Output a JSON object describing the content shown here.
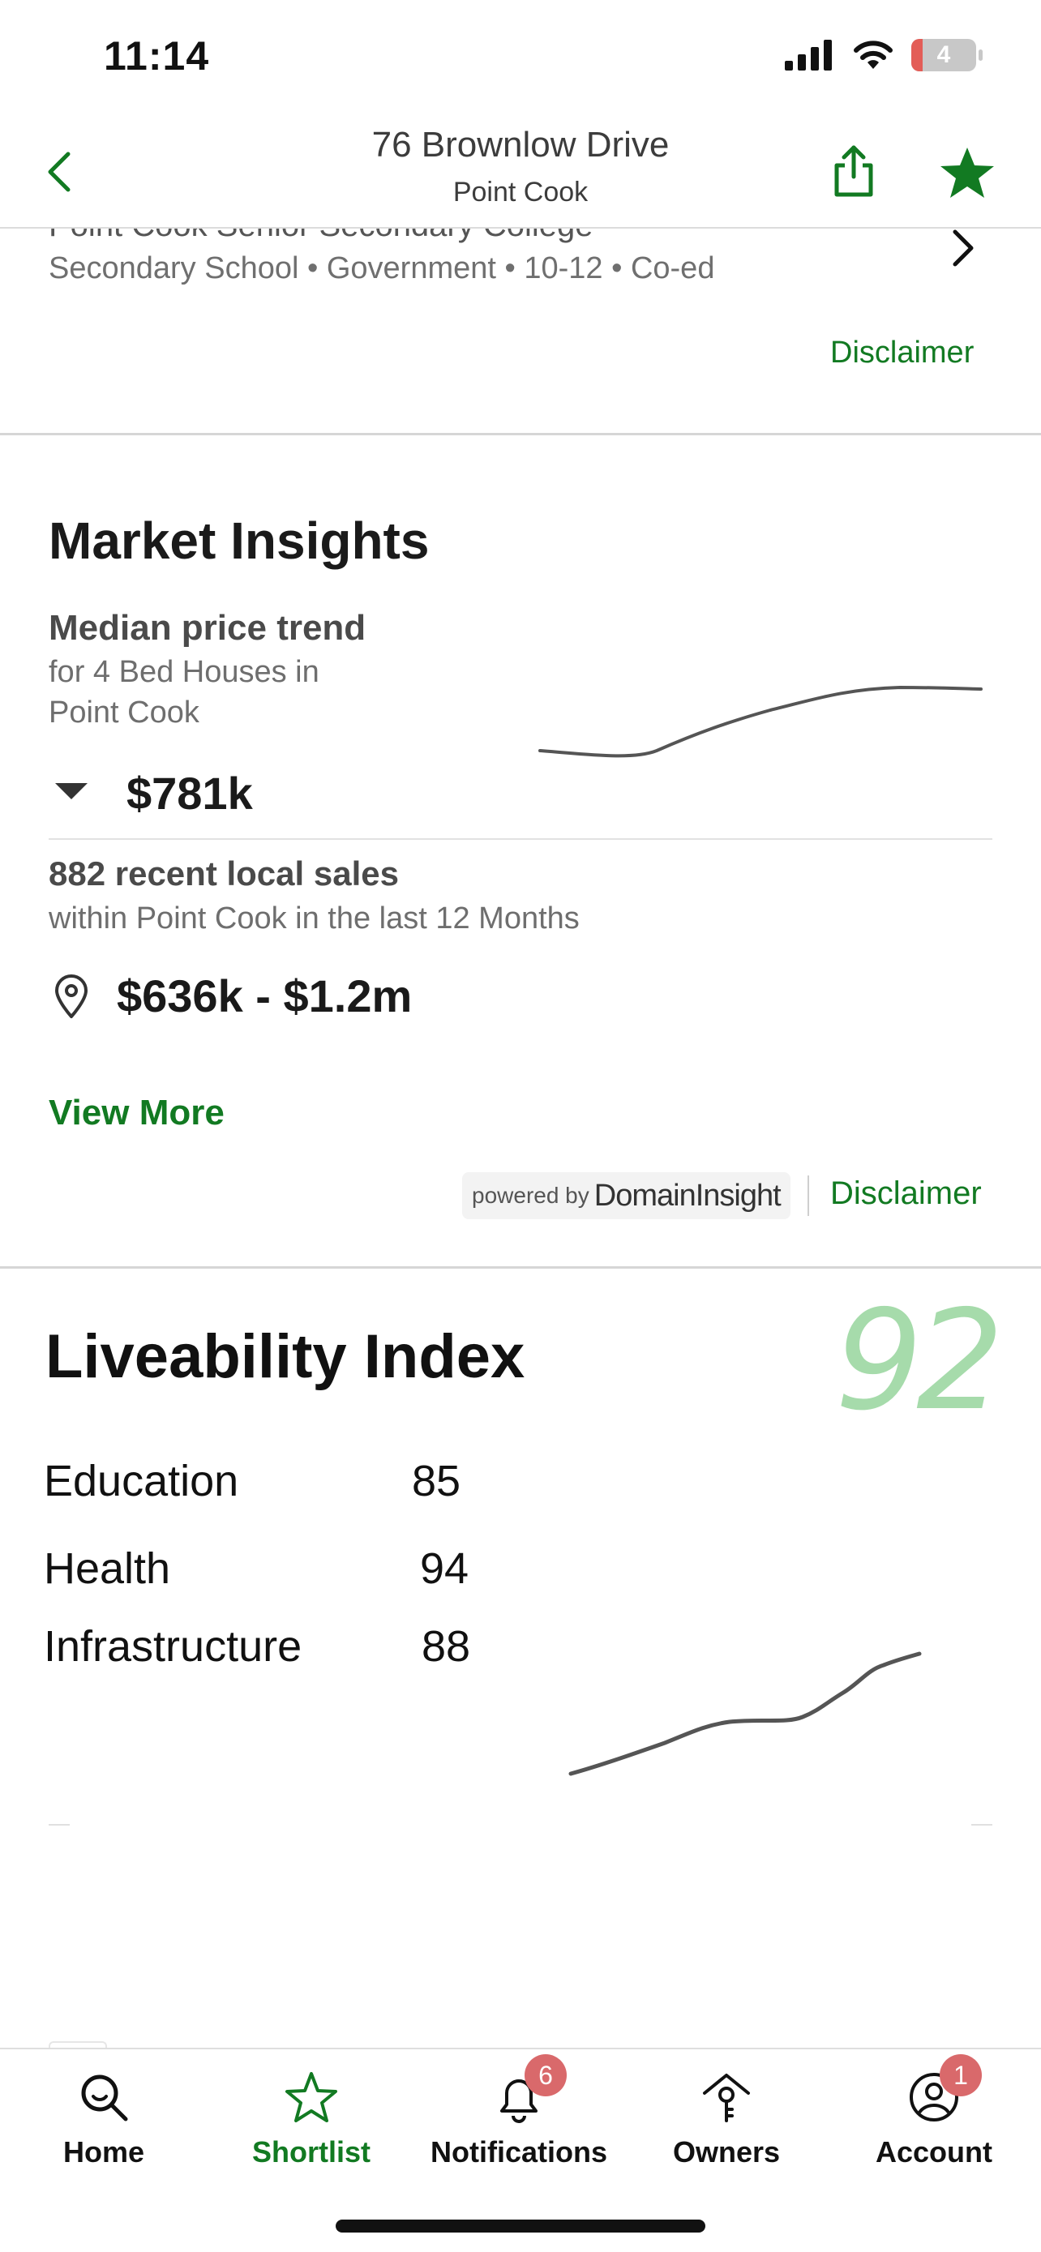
{
  "status_bar": {
    "time": "11:14",
    "battery_level": "4",
    "icons": [
      "signal-icon",
      "wifi-icon",
      "battery-icon"
    ]
  },
  "header": {
    "title": "76 Brownlow Drive",
    "subtitle": "Point Cook",
    "icons": [
      "chevron-left-icon",
      "share-icon",
      "star-icon"
    ]
  },
  "school": {
    "name": "Point Cook Senior Secondary College",
    "meta": "Secondary School • Government • 10-12 • Co-ed",
    "disclaimer": "Disclaimer"
  },
  "market_insights": {
    "title": "Market Insights",
    "subtitle": "Median price trend",
    "desc_line1": "for 4 Bed Houses in",
    "desc_line2": "Point Cook",
    "price": "$781k",
    "sales_title": "882 recent local sales",
    "sales_desc": "within Point Cook in the last 12 Months",
    "sales_range": "$636k - $1.2m",
    "view_more": "View More",
    "powered_by": "powered by",
    "brand": "DomainInsight",
    "disclaimer": "Disclaimer"
  },
  "liveability": {
    "title": "Liveability Index",
    "score": "92",
    "rows": [
      {
        "label": "Education",
        "value": "85"
      },
      {
        "label": "Health",
        "value": "94"
      },
      {
        "label": "Infrastructure",
        "value": "88"
      }
    ]
  },
  "tabs": [
    {
      "label": "Home",
      "icon": "search-icon",
      "active": false,
      "badge": ""
    },
    {
      "label": "Shortlist",
      "icon": "star-outline-icon",
      "active": true,
      "badge": ""
    },
    {
      "label": "Notifications",
      "icon": "bell-icon",
      "active": false,
      "badge": "6"
    },
    {
      "label": "Owners",
      "icon": "house-key-icon",
      "active": false,
      "badge": ""
    },
    {
      "label": "Account",
      "icon": "user-icon",
      "active": false,
      "badge": "1"
    }
  ],
  "colors": {
    "accent": "#127a22",
    "badge": "#d9696b",
    "score": "#a6dbab"
  }
}
